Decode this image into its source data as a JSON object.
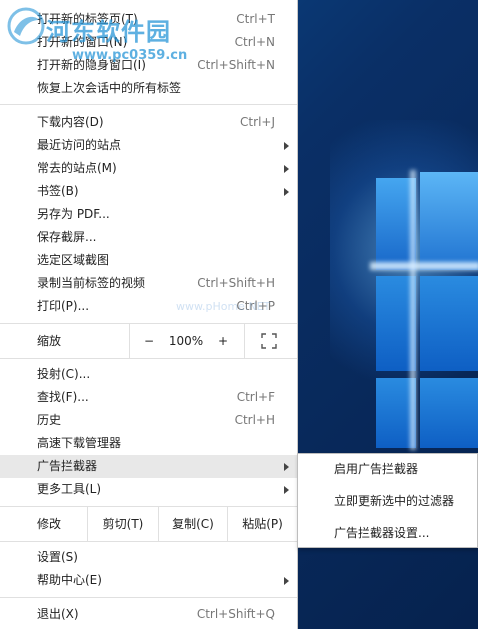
{
  "menu": {
    "items_top": [
      {
        "label": "打开新的标签页(T)",
        "shortcut": "Ctrl+T"
      },
      {
        "label": "打开新的窗口(N)",
        "shortcut": "Ctrl+N"
      },
      {
        "label": "打开新的隐身窗口(I)",
        "shortcut": "Ctrl+Shift+N"
      },
      {
        "label": "恢复上次会话中的所有标签",
        "shortcut": ""
      }
    ],
    "items_mid": [
      {
        "label": "下载内容(D)",
        "shortcut": "Ctrl+J"
      },
      {
        "label": "最近访问的站点",
        "shortcut": ""
      },
      {
        "label": "常去的站点(M)",
        "shortcut": ""
      },
      {
        "label": "书签(B)",
        "shortcut": ""
      },
      {
        "label": "另存为 PDF...",
        "shortcut": ""
      },
      {
        "label": "保存截屏...",
        "shortcut": ""
      },
      {
        "label": "选定区域截图",
        "shortcut": ""
      },
      {
        "label": "录制当前标签的视频",
        "shortcut": "Ctrl+Shift+H"
      },
      {
        "label": "打印(P)...",
        "shortcut": "Ctrl+P"
      }
    ],
    "zoom": {
      "label": "缩放",
      "minus": "−",
      "value": "100%",
      "plus": "+"
    },
    "items_lower": [
      {
        "label": "投射(C)...",
        "shortcut": ""
      },
      {
        "label": "查找(F)...",
        "shortcut": "Ctrl+F"
      },
      {
        "label": "历史",
        "shortcut": "Ctrl+H"
      },
      {
        "label": "高速下载管理器",
        "shortcut": ""
      },
      {
        "label": "广告拦截器",
        "shortcut": ""
      },
      {
        "label": "更多工具(L)",
        "shortcut": ""
      }
    ],
    "edit": {
      "label": "修改",
      "cut": "剪切(T)",
      "copy": "复制(C)",
      "paste": "粘贴(P)"
    },
    "items_bottom": [
      {
        "label": "设置(S)",
        "shortcut": ""
      },
      {
        "label": "帮助中心(E)",
        "shortcut": ""
      }
    ],
    "exit": {
      "label": "退出(X)",
      "shortcut": "Ctrl+Shift+Q"
    }
  },
  "submenu": {
    "items": [
      "启用广告拦截器",
      "立即更新选中的过滤器",
      "广告拦截器设置..."
    ]
  },
  "watermark": {
    "title": "河东软件园",
    "url": "www.pc0359.cn",
    "faint": "www.pHome.NET"
  },
  "colors": {
    "highlight": "#e8e8e8",
    "separator": "#e0e0e0",
    "watermark": "#2896d7"
  }
}
